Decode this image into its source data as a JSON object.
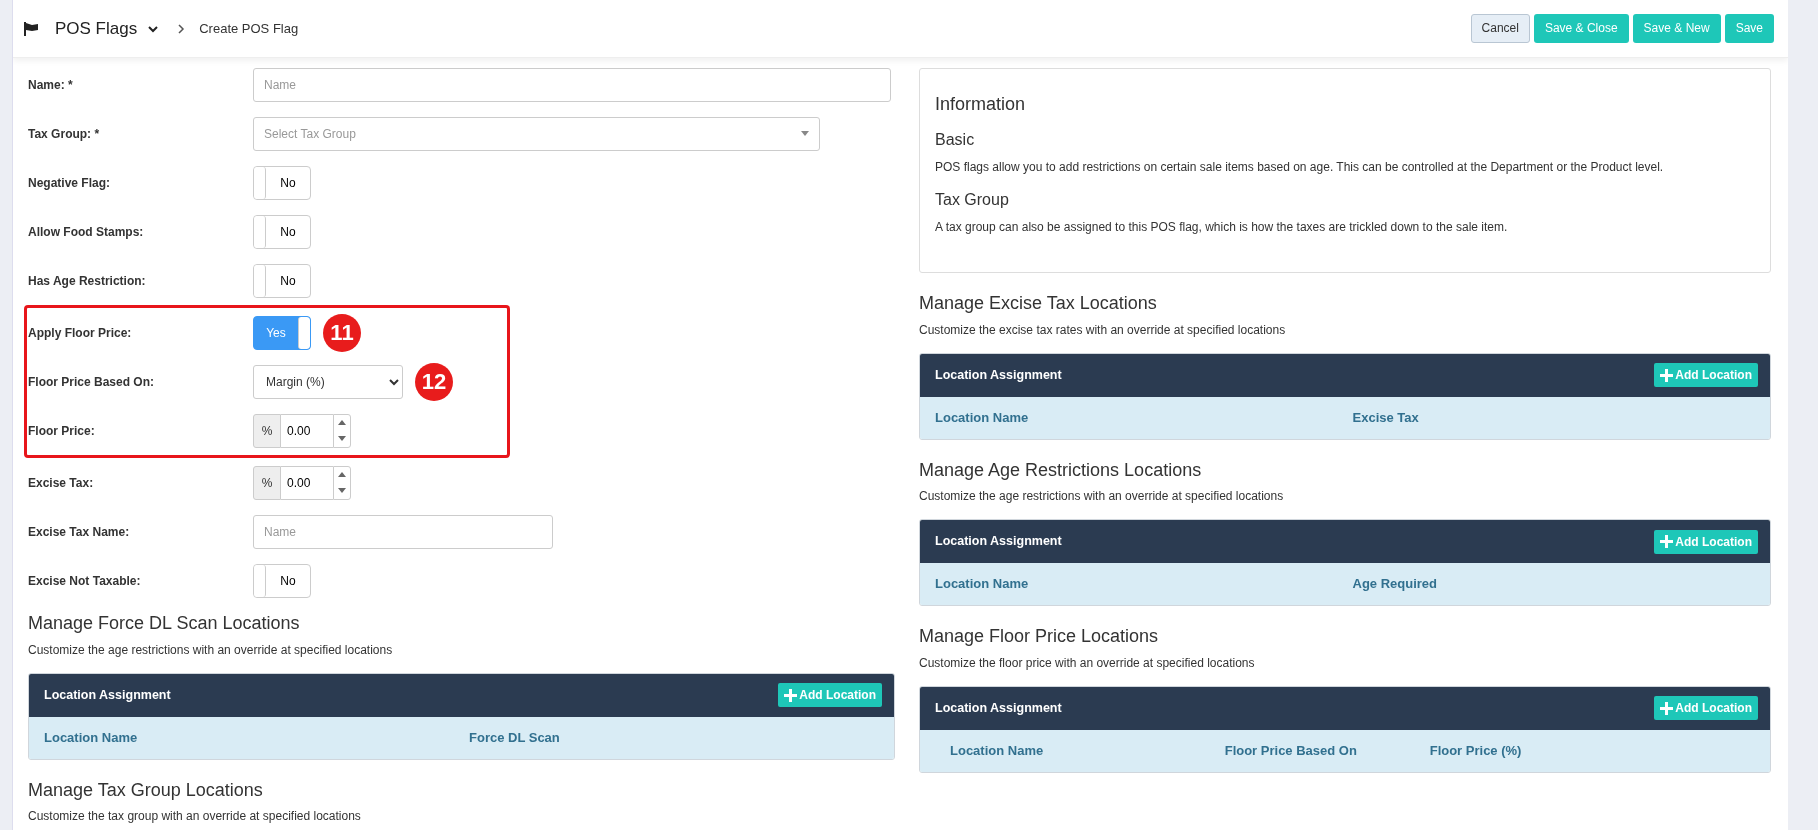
{
  "header": {
    "title": "POS Flags",
    "breadcrumb": "Create POS Flag",
    "buttons": [
      {
        "label": "Cancel",
        "kind": "secondary"
      },
      {
        "label": "Save & Close",
        "kind": "primary"
      },
      {
        "label": "Save & New",
        "kind": "primary"
      },
      {
        "label": "Save",
        "kind": "primary"
      }
    ]
  },
  "form": {
    "groups": [
      {
        "highlighted": false,
        "fields": [
          {
            "label": "Name: *",
            "kind": "text",
            "placeholder": "Name"
          },
          {
            "label": "Tax Group: *",
            "kind": "dropdown",
            "placeholder": "Select Tax Group"
          },
          {
            "label": "Negative Flag:",
            "kind": "toggle",
            "on": false,
            "text": "No"
          },
          {
            "label": "Allow Food Stamps:",
            "kind": "toggle",
            "on": false,
            "text": "No"
          },
          {
            "label": "Has Age Restriction:",
            "kind": "toggle",
            "on": false,
            "text": "No"
          }
        ]
      },
      {
        "highlighted": true,
        "fields": [
          {
            "label": "Apply Floor Price:",
            "kind": "toggle",
            "on": true,
            "text": "Yes",
            "callout": "11"
          },
          {
            "label": "Floor Price Based On:",
            "kind": "select",
            "value": "Margin (%)",
            "callout": "12"
          },
          {
            "label": "Floor Price:",
            "kind": "number",
            "addon": "%",
            "value": "0.00"
          }
        ]
      },
      {
        "highlighted": false,
        "fields": [
          {
            "label": "Excise Tax:",
            "kind": "number",
            "addon": "%",
            "value": "0.00"
          },
          {
            "label": "Excise Tax Name:",
            "kind": "shorttext",
            "placeholder": "Name"
          },
          {
            "label": "Excise Not Taxable:",
            "kind": "toggle",
            "on": false,
            "text": "No"
          }
        ]
      }
    ]
  },
  "left_sections": [
    {
      "title": "Manage Force DL Scan Locations",
      "description": "Customize the age restrictions with an override at specified locations",
      "table": {
        "title": "Location Assignment",
        "button": "Add Location",
        "columns": [
          "Location Name",
          "Force DL Scan"
        ]
      }
    },
    {
      "title": "Manage Tax Group Locations",
      "description": "Customize the tax group with an override at specified locations"
    }
  ],
  "info": {
    "title": "Information",
    "items": [
      {
        "heading": "Basic",
        "text": "POS flags allow you to add restrictions on certain sale items based on age. This can be controlled at the Department or the Product level."
      },
      {
        "heading": "Tax Group",
        "text": "A tax group can also be assigned to this POS flag, which is how the taxes are trickled down to the sale item."
      }
    ]
  },
  "right_sections": [
    {
      "title": "Manage Excise Tax Locations",
      "description": "Customize the excise tax rates with an override at specified locations",
      "table": {
        "title": "Location Assignment",
        "button": "Add Location",
        "columns": [
          "Location Name",
          "Excise Tax"
        ]
      }
    },
    {
      "title": "Manage Age Restrictions Locations",
      "description": "Customize the age restrictions with an override at specified locations",
      "table": {
        "title": "Location Assignment",
        "button": "Add Location",
        "columns": [
          "Location Name",
          "Age Required"
        ]
      }
    },
    {
      "title": "Manage Floor Price Locations",
      "description": "Customize the floor price with an override at specified locations",
      "table": {
        "title": "Location Assignment",
        "button": "Add Location",
        "columns": [
          "Location Name",
          "Floor Price Based On",
          "Floor Price (%)"
        ]
      }
    }
  ]
}
